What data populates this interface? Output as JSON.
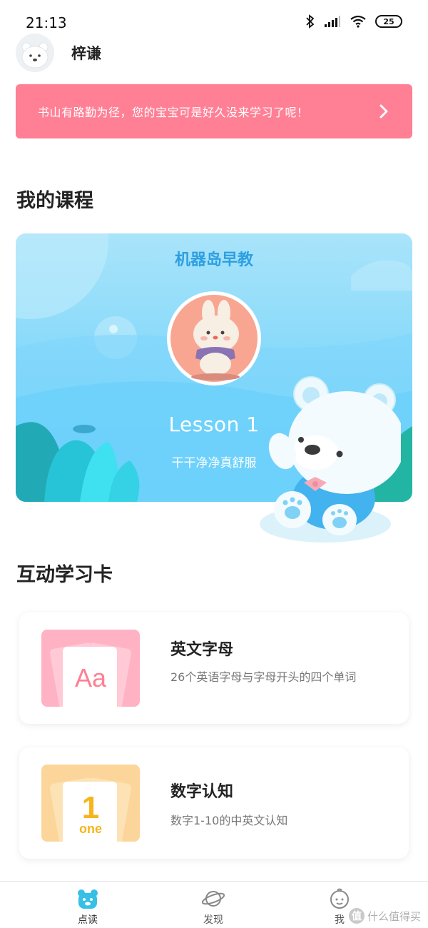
{
  "status_bar": {
    "time": "21:13",
    "battery": "25"
  },
  "header": {
    "username": "梓谦"
  },
  "banner": {
    "text": "书山有路勤为径，您的宝宝可是好久没来学习了呢！"
  },
  "sections": {
    "my_courses": "我的课程",
    "interactive_cards": "互动学习卡"
  },
  "course": {
    "title": "机器岛早教",
    "lesson": "Lesson 1",
    "subtitle": "干干净净真舒服"
  },
  "learn_cards": [
    {
      "title": "英文字母",
      "description": "26个英语字母与字母开头的四个单词",
      "thumb_text": "Aa"
    },
    {
      "title": "数字认知",
      "description": "数字1-10的中英文认知",
      "thumb_number": "1",
      "thumb_word": "one"
    }
  ],
  "tabs": [
    {
      "label": "点读",
      "icon": "bear-icon"
    },
    {
      "label": "发现",
      "icon": "planet-icon"
    },
    {
      "label": "我",
      "icon": "baby-face-icon"
    }
  ],
  "watermark": {
    "text": "什么值得买",
    "badge": "值"
  },
  "colors": {
    "banner": "#ff7f94",
    "course_title": "#2e9fe0",
    "sky": "#9fe0f9",
    "tab_active": "#36c0e6"
  }
}
